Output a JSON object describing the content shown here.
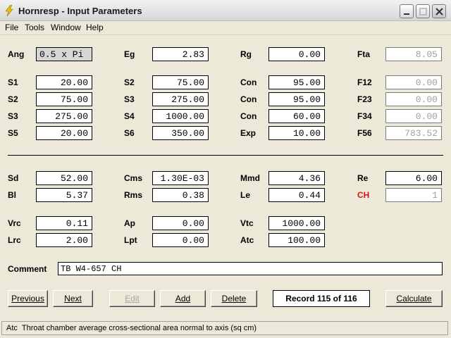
{
  "window": {
    "title": "Hornresp - Input Parameters"
  },
  "menu": [
    "File",
    "Tools",
    "Window",
    "Help"
  ],
  "params": {
    "ang": {
      "label": "Ang",
      "value": "0.5 x Pi"
    },
    "eg": {
      "label": "Eg",
      "value": "2.83"
    },
    "rg": {
      "label": "Rg",
      "value": "0.00"
    },
    "fta": {
      "label": "Fta",
      "value": "8.05"
    },
    "r1": {
      "c1": {
        "label": "S1",
        "value": "20.00"
      },
      "c2": {
        "label": "S2",
        "value": "75.00"
      },
      "c3": {
        "label": "Con",
        "value": "95.00"
      },
      "c4": {
        "label": "F12",
        "value": "0.00"
      }
    },
    "r2": {
      "c1": {
        "label": "S2",
        "value": "75.00"
      },
      "c2": {
        "label": "S3",
        "value": "275.00"
      },
      "c3": {
        "label": "Con",
        "value": "95.00"
      },
      "c4": {
        "label": "F23",
        "value": "0.00"
      }
    },
    "r3": {
      "c1": {
        "label": "S3",
        "value": "275.00"
      },
      "c2": {
        "label": "S4",
        "value": "1000.00"
      },
      "c3": {
        "label": "Con",
        "value": "60.00"
      },
      "c4": {
        "label": "F34",
        "value": "0.00"
      }
    },
    "r4": {
      "c1": {
        "label": "S5",
        "value": "20.00"
      },
      "c2": {
        "label": "S6",
        "value": "350.00"
      },
      "c3": {
        "label": "Exp",
        "value": "10.00"
      },
      "c4": {
        "label": "F56",
        "value": "783.52"
      }
    },
    "sd": {
      "label": "Sd",
      "value": "52.00"
    },
    "cms": {
      "label": "Cms",
      "value": "1.30E-03"
    },
    "mmd": {
      "label": "Mmd",
      "value": "4.36"
    },
    "re": {
      "label": "Re",
      "value": "6.00"
    },
    "bl": {
      "label": "Bl",
      "value": "5.37"
    },
    "rms": {
      "label": "Rms",
      "value": "0.38"
    },
    "le": {
      "label": "Le",
      "value": "0.44"
    },
    "ch": {
      "label": "CH",
      "value": "1"
    },
    "vrc": {
      "label": "Vrc",
      "value": "0.11"
    },
    "ap": {
      "label": "Ap",
      "value": "0.00"
    },
    "vtc": {
      "label": "Vtc",
      "value": "1000.00"
    },
    "lrc": {
      "label": "Lrc",
      "value": "2.00"
    },
    "lpt": {
      "label": "Lpt",
      "value": "0.00"
    },
    "atc": {
      "label": "Atc",
      "value": "100.00"
    }
  },
  "comment": {
    "label": "Comment",
    "value": "TB W4-657 CH"
  },
  "buttons": {
    "previous": "Previous",
    "next": "Next",
    "edit": "Edit",
    "add": "Add",
    "delete": "Delete",
    "calculate": "Calculate"
  },
  "record": "Record 115 of 116",
  "status": {
    "code": "Atc",
    "text": "Throat chamber average cross-sectional area normal to axis  (sq cm)"
  },
  "colors": {
    "ch_label": "#E01010",
    "disabled_text": "#A0A0A0",
    "background": "#ECE9D8"
  }
}
